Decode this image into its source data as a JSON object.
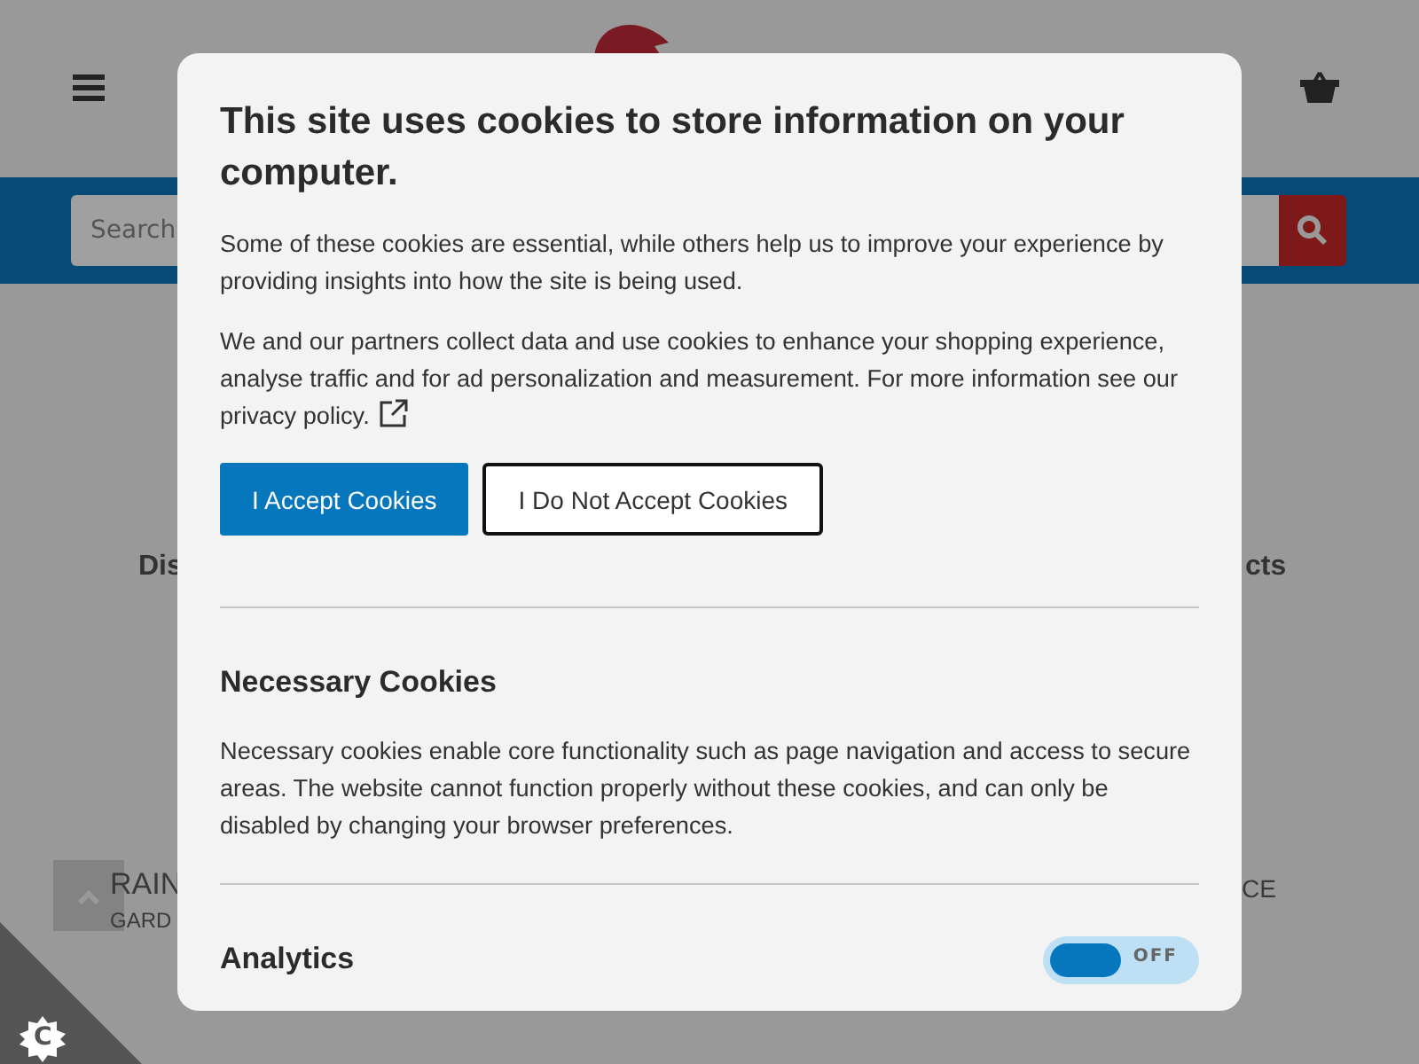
{
  "page": {
    "search": {
      "placeholder": "Search"
    },
    "section_left": "Dis",
    "section_right": "cts",
    "product_left": {
      "name": "RAIN",
      "category": "GARD"
    },
    "product_right": {
      "name": "CE"
    },
    "cookie_badge": "C"
  },
  "dialog": {
    "title": "This site uses cookies to store information on your computer.",
    "intro": "Some of these cookies are essential, while others help us to improve your experience by providing insights into how the site is being used.",
    "notice": "We and our partners collect data and use cookies to enhance your shopping experience, analyse traffic and for ad personalization and measurement. For more information see our",
    "policy_link": "privacy policy.",
    "buttons": [
      {
        "label": "I Accept Cookies",
        "kind": "primary"
      },
      {
        "label": "I Do Not Accept Cookies",
        "kind": "outline"
      }
    ],
    "sections": [
      {
        "title": "Necessary Cookies",
        "text": "Necessary cookies enable core functionality such as page navigation and access to secure areas. The website cannot function properly without these cookies, and can only be disabled by changing your browser preferences."
      },
      {
        "title": "Analytics",
        "toggle": {
          "on": false,
          "label": "OFF"
        }
      }
    ]
  }
}
